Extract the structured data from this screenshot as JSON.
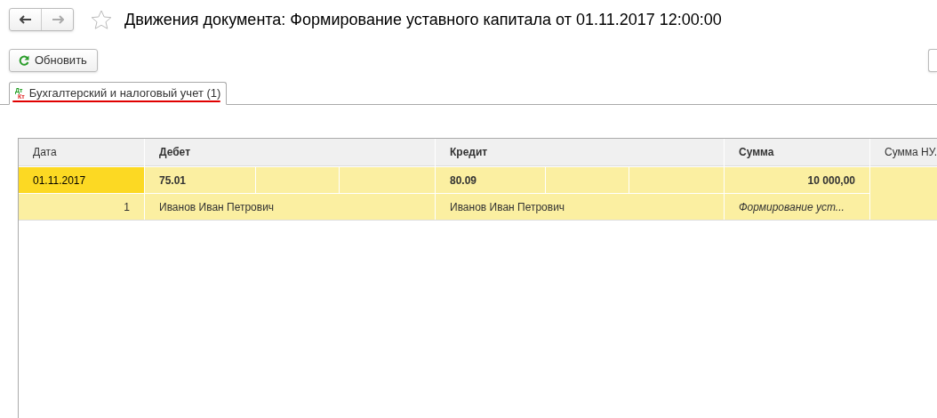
{
  "window": {
    "title": "Движения документа: Формирование уставного капитала от 01.11.2017 12:00:00",
    "favorite": false
  },
  "toolbar": {
    "refresh_button": "Обновить"
  },
  "tabs": [
    {
      "icon_top": "Дт",
      "icon_bottom": "Кт",
      "label": "Бухгалтерский и налоговый учет (1)",
      "selected": true,
      "underlined": true
    }
  ],
  "table": {
    "columns": [
      {
        "label": "Дата",
        "bold": false
      },
      {
        "label": "Дебет",
        "bold": true
      },
      {
        "label": "Кредит",
        "bold": true
      },
      {
        "label": "Сумма",
        "bold": true
      },
      {
        "label": "Сумма НУ.",
        "bold": false
      }
    ],
    "rows": [
      {
        "selected": true,
        "date": "01.11.2017",
        "number": "1",
        "debit_account": "75.01",
        "debit": "Иванов Иван Петрович",
        "credit_account": "80.09",
        "credit": "Иванов Иван Петрович",
        "amount": "10 000,00",
        "content": "Формирование уст..."
      }
    ]
  }
}
